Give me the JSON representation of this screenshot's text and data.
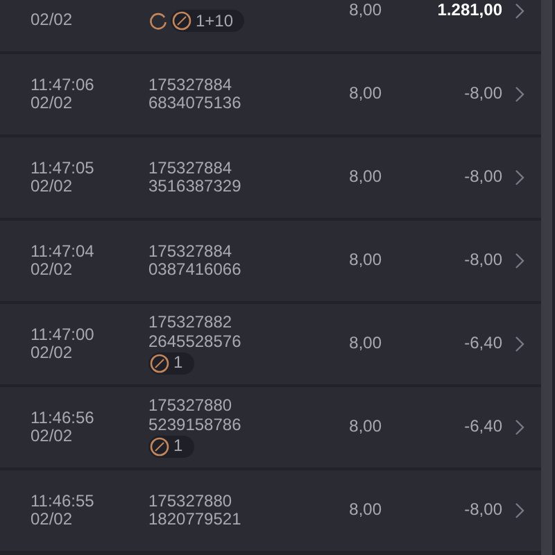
{
  "rows": [
    {
      "date": "02/02",
      "ids": [],
      "badges": [
        {
          "kind": "refresh"
        },
        {
          "kind": "compass",
          "count": "1+10"
        }
      ],
      "amount": "8,00",
      "result": "1.281,00",
      "highlight": true
    },
    {
      "time": "11:47:06",
      "date": "02/02",
      "ids": [
        "175327884",
        "6834075136"
      ],
      "badges": [],
      "amount": "8,00",
      "result": "-8,00",
      "highlight": false
    },
    {
      "time": "11:47:05",
      "date": "02/02",
      "ids": [
        "175327884",
        "3516387329"
      ],
      "badges": [],
      "amount": "8,00",
      "result": "-8,00",
      "highlight": false
    },
    {
      "time": "11:47:04",
      "date": "02/02",
      "ids": [
        "175327884",
        "0387416066"
      ],
      "badges": [],
      "amount": "8,00",
      "result": "-8,00",
      "highlight": false
    },
    {
      "time": "11:47:00",
      "date": "02/02",
      "ids": [
        "175327882",
        "2645528576"
      ],
      "badges": [
        {
          "kind": "compass",
          "count": "1"
        }
      ],
      "amount": "8,00",
      "result": "-6,40",
      "highlight": false
    },
    {
      "time": "11:46:56",
      "date": "02/02",
      "ids": [
        "175327880",
        "5239158786"
      ],
      "badges": [
        {
          "kind": "compass",
          "count": "1"
        }
      ],
      "amount": "8,00",
      "result": "-6,40",
      "highlight": false
    },
    {
      "time": "11:46:55",
      "date": "02/02",
      "ids": [
        "175327880",
        "1820779521"
      ],
      "badges": [],
      "amount": "8,00",
      "result": "-8,00",
      "highlight": false
    }
  ]
}
